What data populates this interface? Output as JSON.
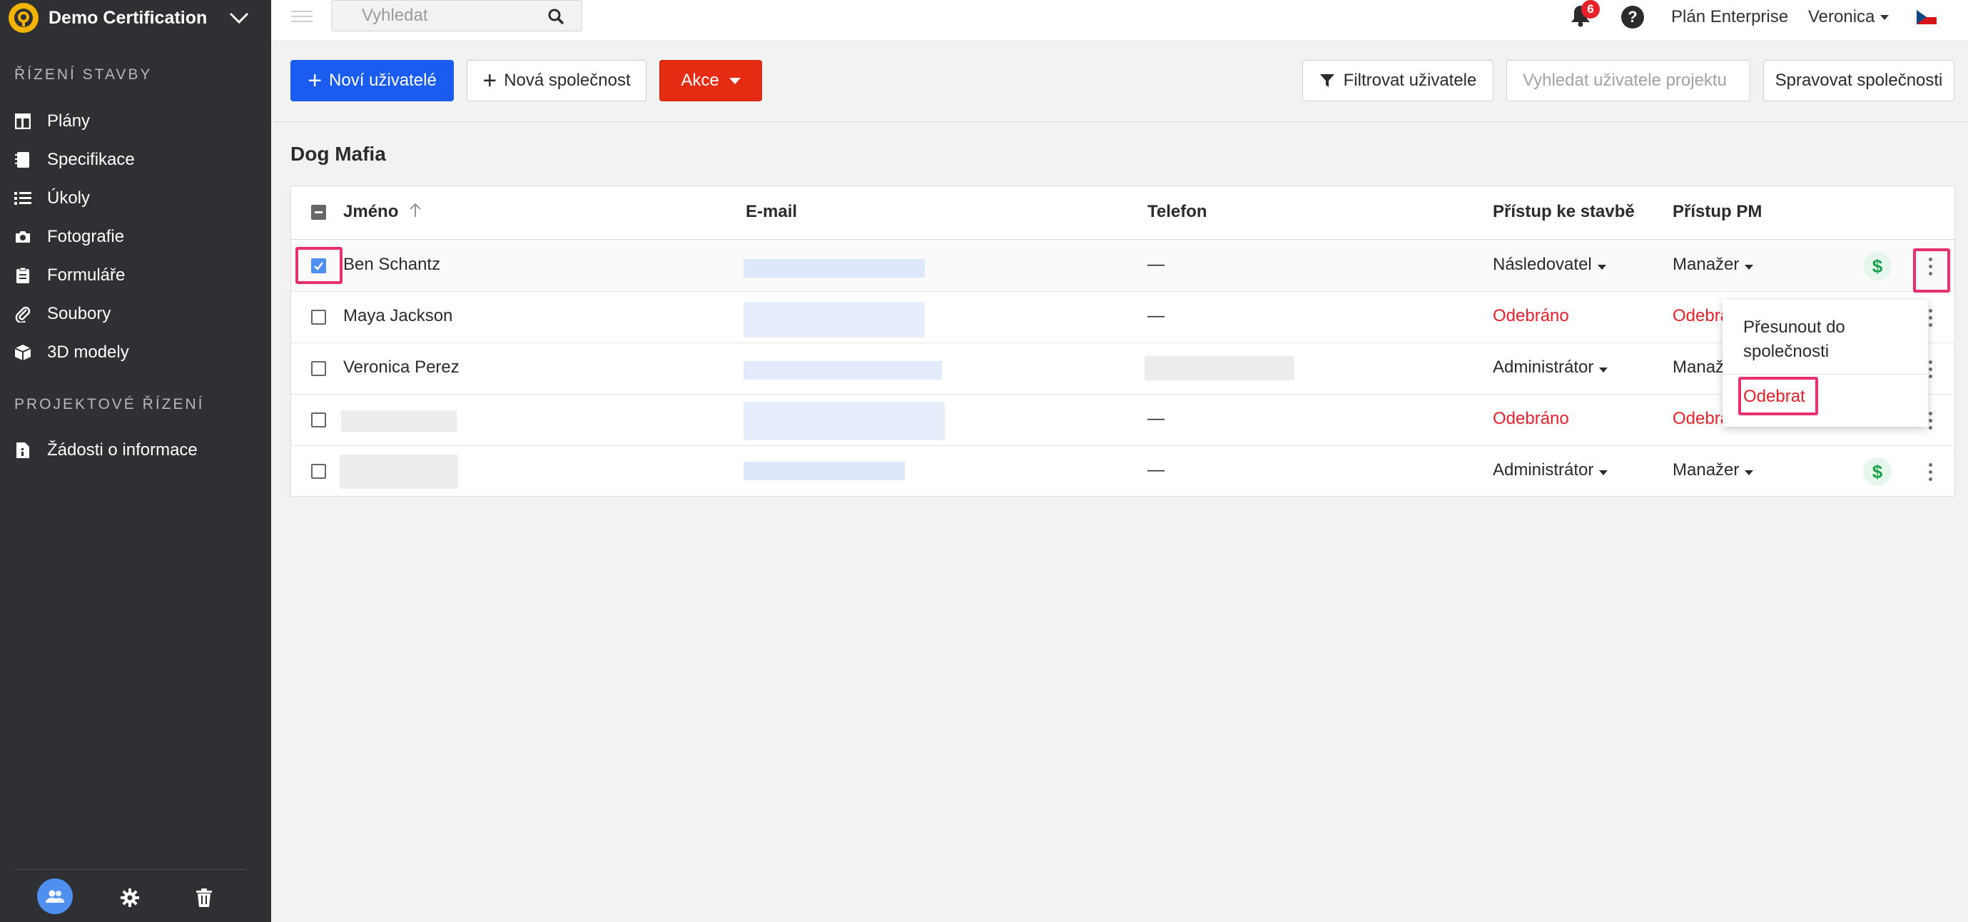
{
  "sidebar": {
    "project_title": "Demo Certification",
    "section_construction": "ŘÍZENÍ STAVBY",
    "section_project": "PROJEKTOVÉ ŘÍZENÍ",
    "items": [
      {
        "label": "Plány",
        "icon": "plans-icon"
      },
      {
        "label": "Specifikace",
        "icon": "specs-icon"
      },
      {
        "label": "Úkoly",
        "icon": "tasks-icon"
      },
      {
        "label": "Fotografie",
        "icon": "camera-icon"
      },
      {
        "label": "Formuláře",
        "icon": "clipboard-icon"
      },
      {
        "label": "Soubory",
        "icon": "paperclip-icon"
      },
      {
        "label": "3D modely",
        "icon": "cube-icon"
      }
    ],
    "project_items": [
      {
        "label": "Žádosti o informace",
        "icon": "rfi-icon"
      }
    ]
  },
  "topbar": {
    "search_placeholder": "Vyhledat",
    "notification_count": "6",
    "help": "?",
    "plan": "Plán Enterprise",
    "user": "Veronica"
  },
  "toolbar": {
    "new_users": "Noví uživatelé",
    "new_company": "Nová společnost",
    "actions": "Akce",
    "filter_users": "Filtrovat uživatele",
    "search_project_users_placeholder": "Vyhledat uživatele projektu",
    "manage_companies": "Spravovat společnosti"
  },
  "company": {
    "name": "Dog Mafia"
  },
  "table": {
    "headers": {
      "name": "Jméno",
      "email": "E-mail",
      "phone": "Telefon",
      "construction_access": "Přístup ke stavbě",
      "pm_access": "Přístup PM"
    },
    "rows": [
      {
        "name": "Ben Schantz",
        "phone": "—",
        "construction": "Následovatel",
        "pm": "Manažer",
        "checked": true
      },
      {
        "name": "Maya Jackson",
        "phone": "—",
        "construction": "Odebráno",
        "pm": "Odebráno",
        "checked": false
      },
      {
        "name": "Veronica Perez",
        "phone": "",
        "construction": "Administrátor",
        "pm": "Manažer",
        "checked": false
      },
      {
        "name": "",
        "phone": "—",
        "construction": "Odebráno",
        "pm": "Odebráno",
        "checked": false
      },
      {
        "name": "",
        "phone": "—",
        "construction": "Administrátor",
        "pm": "Manažer",
        "checked": false
      }
    ]
  },
  "row_menu": {
    "move_to_company": "Přesunout do společnosti",
    "remove": "Odebrat"
  },
  "colors": {
    "primary": "#1a5cf0",
    "danger": "#e52b12",
    "removed_text": "#e8202a",
    "highlight": "#e8306f",
    "sidebar_bg": "#2f3033"
  }
}
